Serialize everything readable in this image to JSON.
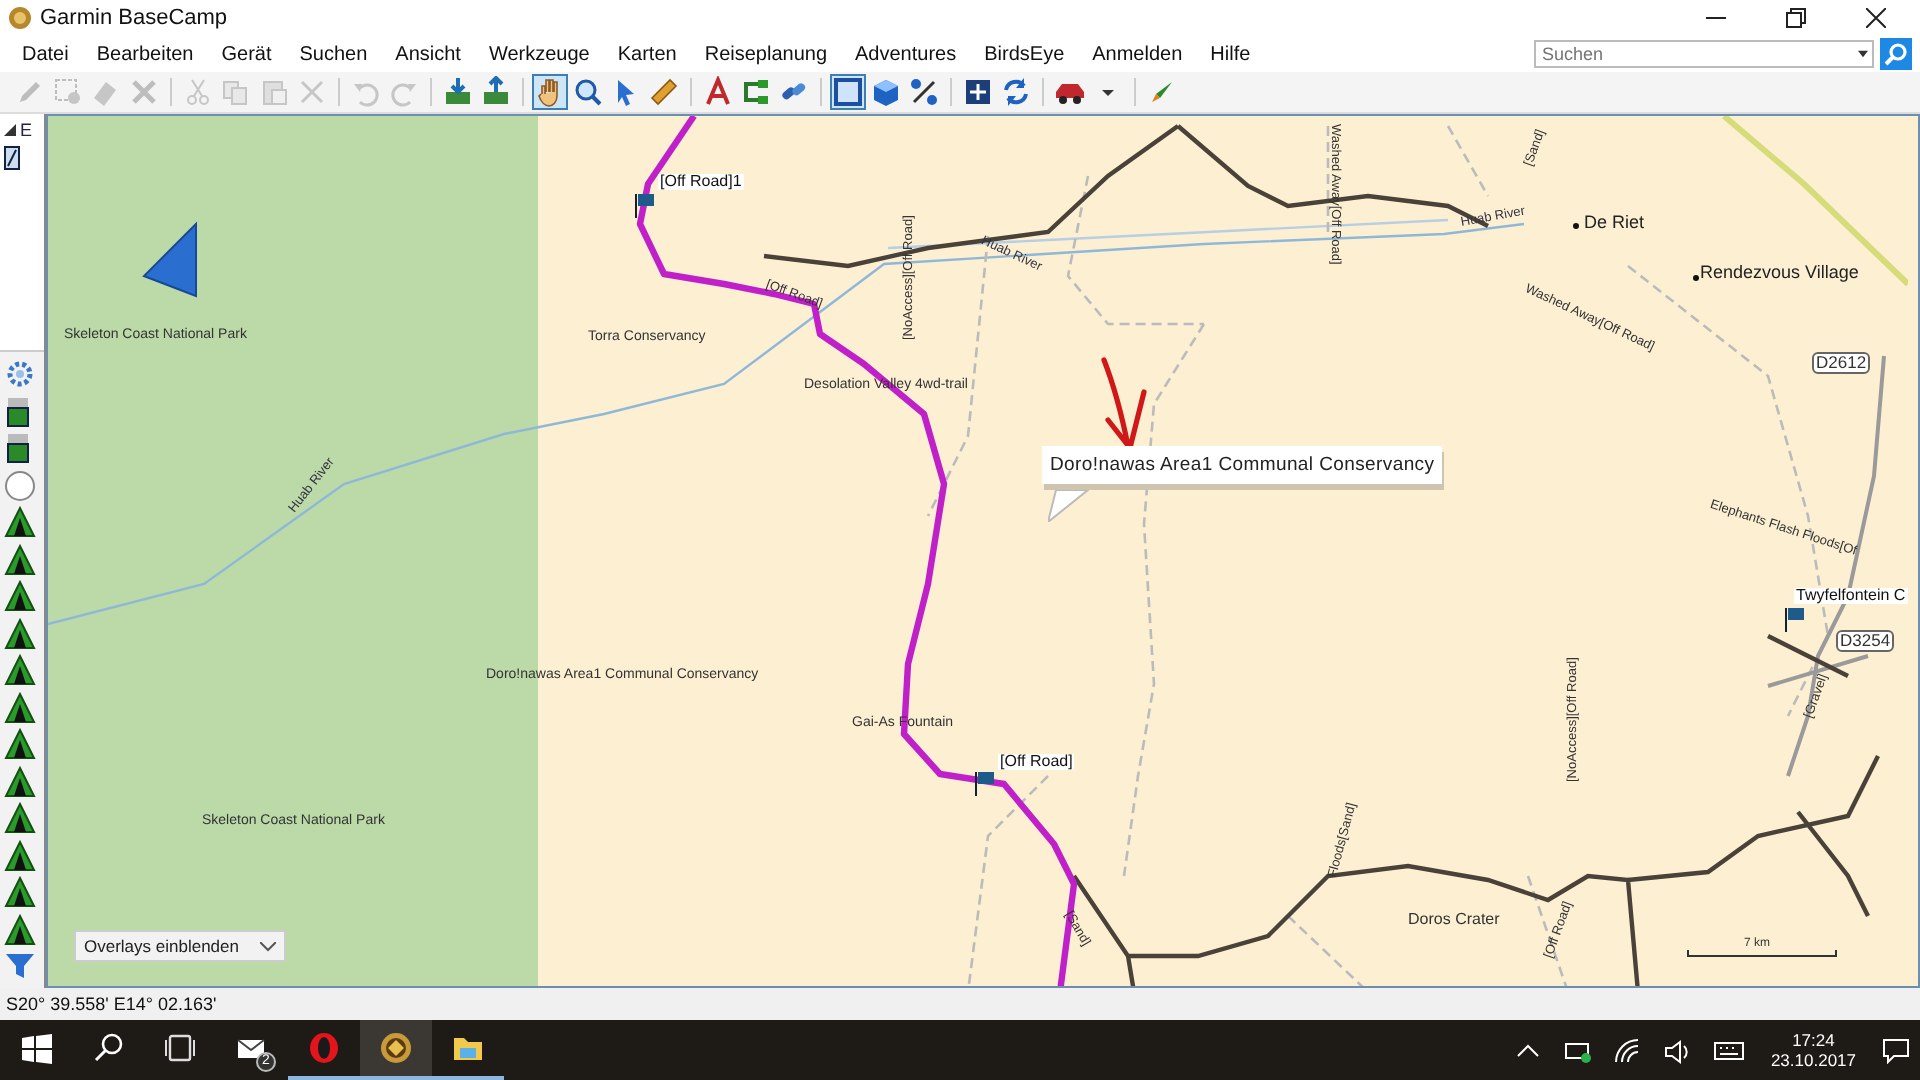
{
  "window": {
    "title": "Garmin BaseCamp"
  },
  "menu": [
    "Datei",
    "Bearbeiten",
    "Gerät",
    "Suchen",
    "Ansicht",
    "Werkzeuge",
    "Karten",
    "Reiseplanung",
    "Adventures",
    "BirdsEye",
    "Anmelden",
    "Hilfe"
  ],
  "search": {
    "placeholder": "Suchen"
  },
  "toolbar": [
    [
      {
        "kind": "pencil",
        "disabled": true,
        "selected": false
      },
      {
        "kind": "select-box",
        "disabled": true,
        "selected": false
      },
      {
        "kind": "eraser",
        "disabled": true,
        "selected": false
      },
      {
        "kind": "tools",
        "disabled": true,
        "selected": false
      }
    ],
    [
      {
        "kind": "cut",
        "disabled": true,
        "selected": false
      },
      {
        "kind": "copy",
        "disabled": true,
        "selected": false
      },
      {
        "kind": "paste",
        "disabled": true,
        "selected": false
      },
      {
        "kind": "delete",
        "disabled": true,
        "selected": false
      }
    ],
    [
      {
        "kind": "undo",
        "disabled": true,
        "selected": false
      },
      {
        "kind": "redo",
        "disabled": true,
        "selected": false
      }
    ],
    [
      {
        "kind": "send",
        "disabled": false,
        "selected": false
      },
      {
        "kind": "receive",
        "disabled": false,
        "selected": false
      }
    ],
    [
      {
        "kind": "hand",
        "disabled": false,
        "selected": true
      },
      {
        "kind": "zoom",
        "disabled": false,
        "selected": false
      },
      {
        "kind": "pointer",
        "disabled": false,
        "selected": false
      },
      {
        "kind": "ruler",
        "disabled": false,
        "selected": false
      }
    ],
    [
      {
        "kind": "letter",
        "disabled": false,
        "selected": false
      },
      {
        "kind": "route",
        "disabled": false,
        "selected": false
      },
      {
        "kind": "link",
        "disabled": false,
        "selected": false
      }
    ],
    [
      {
        "kind": "frame",
        "disabled": false,
        "selected": true
      },
      {
        "kind": "cube",
        "disabled": false,
        "selected": false
      },
      {
        "kind": "percent",
        "disabled": false,
        "selected": false
      }
    ],
    [
      {
        "kind": "fit",
        "disabled": false,
        "selected": false
      },
      {
        "kind": "sync",
        "disabled": false,
        "selected": false
      }
    ],
    [
      {
        "kind": "car",
        "disabled": false,
        "selected": false
      },
      {
        "kind": "caret",
        "disabled": false,
        "selected": false
      }
    ],
    [
      {
        "kind": "rocket",
        "disabled": false,
        "selected": false
      }
    ]
  ],
  "sidebar": {
    "tree_item": {
      "label": "E",
      "expanded": true
    },
    "icons": [
      {
        "kind": "gear"
      },
      {
        "kind": "fuel"
      },
      {
        "kind": "fuel"
      },
      {
        "kind": "circle"
      },
      {
        "kind": "tent"
      },
      {
        "kind": "tent"
      },
      {
        "kind": "tent"
      },
      {
        "kind": "tent"
      },
      {
        "kind": "tent"
      },
      {
        "kind": "tent"
      },
      {
        "kind": "tent"
      },
      {
        "kind": "tent"
      },
      {
        "kind": "tent"
      },
      {
        "kind": "tent"
      },
      {
        "kind": "tent"
      },
      {
        "kind": "tent"
      },
      {
        "kind": "filter"
      }
    ]
  },
  "map": {
    "labels": [
      {
        "text": "[Off Road]1",
        "kind": "waypoint"
      },
      {
        "text": "Skeleton Coast National Park",
        "kind": "area"
      },
      {
        "text": "Torra Conservancy",
        "kind": "area"
      },
      {
        "text": "[Off Road]",
        "kind": "road"
      },
      {
        "text": "[NoAccess][Off Road]",
        "kind": "road"
      },
      {
        "text": "Desolation Valley 4wd-trail",
        "kind": "area"
      },
      {
        "text": "Huab River",
        "kind": "river"
      },
      {
        "text": "Washed Away[Off Road]",
        "kind": "road"
      },
      {
        "text": "[Sand]",
        "kind": "road"
      },
      {
        "text": "Huab River",
        "kind": "river"
      },
      {
        "text": "De Riet",
        "kind": "town"
      },
      {
        "text": "Washed Away[Off Road]",
        "kind": "road"
      },
      {
        "text": "Rendezvous Village",
        "kind": "town"
      },
      {
        "text": "D2612",
        "kind": "shield"
      },
      {
        "text": "Elephants Flash Floods[Of",
        "kind": "road"
      },
      {
        "text": "Twyfelfontein C",
        "kind": "waypoint"
      },
      {
        "text": "D3254",
        "kind": "shield"
      },
      {
        "text": "[Gravel]",
        "kind": "road"
      },
      {
        "text": "Huab River",
        "kind": "river"
      },
      {
        "text": "Doro!nawas Area1 Communal Conservancy",
        "kind": "area"
      },
      {
        "text": "Gai-As Fountain",
        "kind": "area"
      },
      {
        "text": "[Off Road]",
        "kind": "waypoint"
      },
      {
        "text": "Skeleton Coast National Park",
        "kind": "area"
      },
      {
        "text": "[Sand]",
        "kind": "road"
      },
      {
        "text": "Floods[Sand]",
        "kind": "road"
      },
      {
        "text": "Doros Crater",
        "kind": "place"
      },
      {
        "text": "[NoAccess][Off Road]",
        "kind": "road"
      },
      {
        "text": "[Off Road]",
        "kind": "road"
      }
    ],
    "tooltip": "Doro!nawas Area1 Communal Conservancy",
    "overlay_select": "Overlays einblenden",
    "scale": "7 km"
  },
  "status_bar": {
    "coordinates": "S20° 39.558' E14° 02.163'"
  },
  "taskbar": {
    "apps": [
      {
        "kind": "start",
        "running": false,
        "selected": false
      },
      {
        "kind": "search",
        "running": false,
        "selected": false
      },
      {
        "kind": "task-view",
        "running": false,
        "selected": false
      },
      {
        "kind": "mail",
        "running": false,
        "selected": false,
        "badge": "2"
      },
      {
        "kind": "browser",
        "running": true,
        "selected": false
      },
      {
        "kind": "basecamp",
        "running": true,
        "selected": true
      },
      {
        "kind": "folder",
        "running": true,
        "selected": false
      }
    ],
    "tray": [
      {
        "kind": "chevron"
      },
      {
        "kind": "battery"
      },
      {
        "kind": "wifi"
      },
      {
        "kind": "volume"
      },
      {
        "kind": "keyboard"
      }
    ],
    "time": "17:24",
    "date": "23.10.2017"
  }
}
